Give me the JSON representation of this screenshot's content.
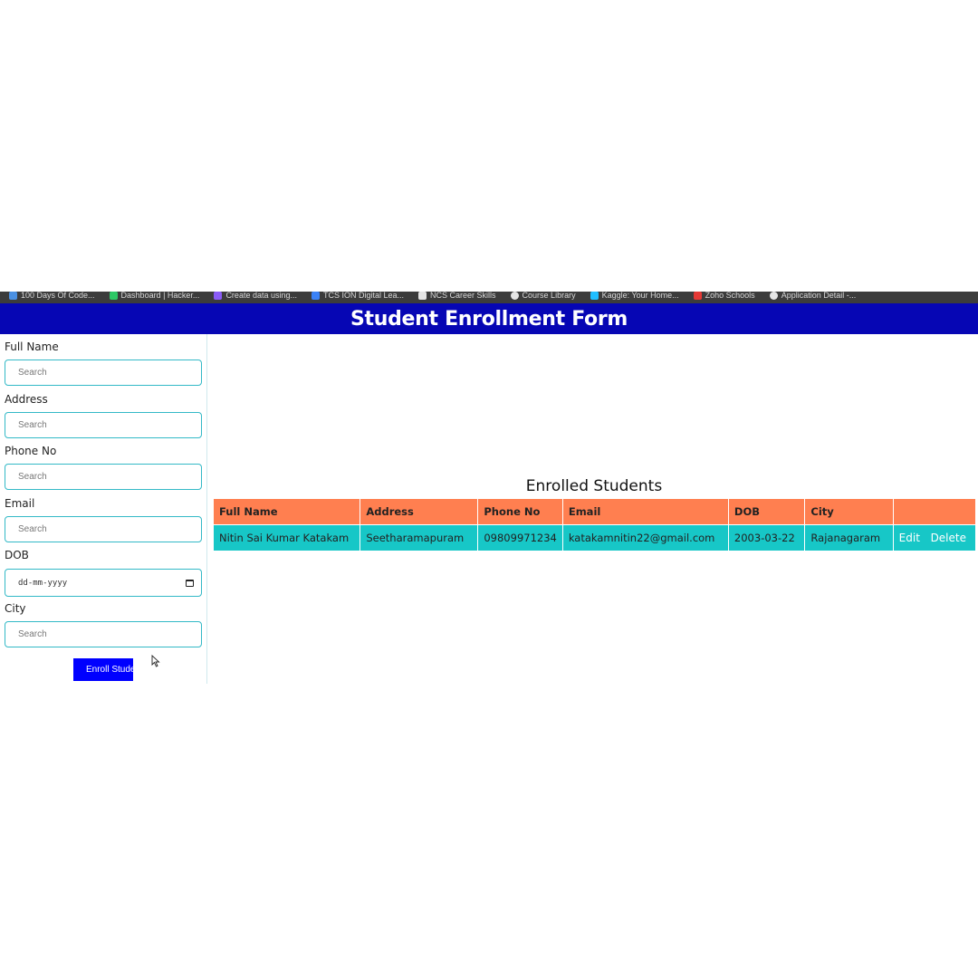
{
  "bookmarks": [
    {
      "label": "100 Days Of Code...",
      "icon": "bookmark-icon",
      "color": "#4a90e2"
    },
    {
      "label": "Dashboard | Hacker...",
      "icon": "bookmark-icon",
      "color": "#2ec866"
    },
    {
      "label": "Create data using...",
      "icon": "bookmark-icon",
      "color": "#8a5cf6"
    },
    {
      "label": "TCS ION Digital Lea...",
      "icon": "bookmark-icon",
      "color": "#3b82f6"
    },
    {
      "label": "NCS Career Skills",
      "icon": "bookmark-icon",
      "color": "#e5e5e5"
    },
    {
      "label": "Course Library",
      "icon": "bookmark-icon",
      "color": "#e5e5e5"
    },
    {
      "label": "Kaggle: Your Home...",
      "icon": "bookmark-icon",
      "color": "#20beff"
    },
    {
      "label": "Zoho Schools",
      "icon": "bookmark-icon",
      "color": "#e53935"
    },
    {
      "label": "Application Detail -...",
      "icon": "bookmark-icon",
      "color": "#e5e5e5"
    }
  ],
  "header": {
    "title": "Student Enrollment Form",
    "background": "#0606b4"
  },
  "form": {
    "fields": [
      {
        "label": "Full Name",
        "placeholder": "Search"
      },
      {
        "label": "Address",
        "placeholder": "Search"
      },
      {
        "label": "Phone No",
        "placeholder": "Search"
      },
      {
        "label": "Email",
        "placeholder": "Search"
      },
      {
        "label": "DOB",
        "placeholder": "dd-mm-yyyy"
      },
      {
        "label": "City",
        "placeholder": "Search"
      }
    ],
    "submit_label": "Enroll Stude",
    "submit_color": "#0000ff"
  },
  "table": {
    "title": "Enrolled Students",
    "header_color": "#ff7f50",
    "row_color": "#17c7c7",
    "columns": [
      "Full Name",
      "Address",
      "Phone No",
      "Email",
      "DOB",
      "City",
      ""
    ],
    "rows": [
      {
        "full_name": "Nitin Sai Kumar Katakam",
        "address": "Seetharamapuram",
        "phone": "09809971234",
        "email": "katakamnitin22@gmail.com",
        "dob": "2003-03-22",
        "city": "Rajanagaram",
        "edit_label": "Edit",
        "delete_label": "Delete"
      }
    ]
  }
}
